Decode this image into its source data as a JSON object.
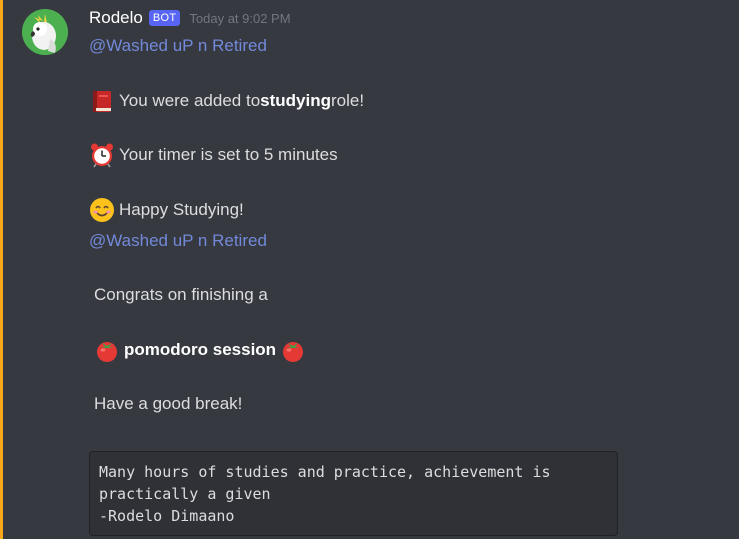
{
  "message": {
    "author": "Rodelo",
    "bot_tag": "BOT",
    "timestamp": "Today at 9:02 PM",
    "accent_color": "#faa61a"
  },
  "first_block": {
    "mention": "@Washed uP n Retired",
    "line1": {
      "icon": "closed-book-icon",
      "prefix": "You were added to ",
      "bold": "studying",
      "suffix": " role!"
    },
    "line2": {
      "icon": "alarm-clock-icon",
      "text": "Your timer is set to 5 minutes"
    },
    "line3": {
      "icon": "smiling-face-icon",
      "text": "Happy Studying!"
    }
  },
  "second_block": {
    "mention": "@Washed uP n Retired",
    "line1": "Congrats on finishing a",
    "line2": {
      "icon": "tomato-icon",
      "bold": "pomodoro session"
    },
    "line3": "Have a good break!"
  },
  "quote": {
    "line1": "Many hours of studies and practice, achievement is",
    "line2": "practically a given",
    "line3": "-Rodelo Dimaano"
  }
}
